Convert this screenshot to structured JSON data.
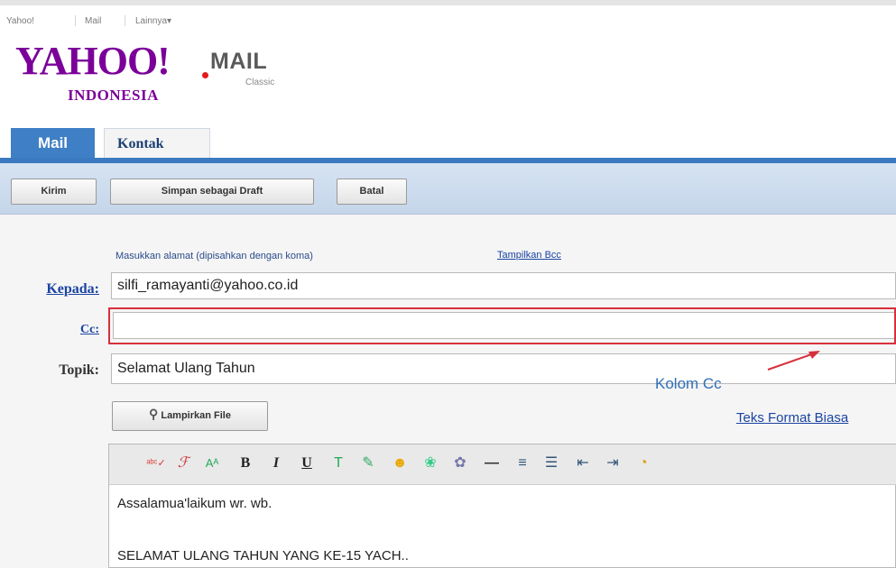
{
  "top_links": [
    "Yahoo!",
    "Mail",
    "Lainnya▾"
  ],
  "logo": {
    "main": "YAHOO!",
    "sub": "INDONESIA",
    "product": "MAIL",
    "edition": "Classic"
  },
  "tabs": [
    {
      "label": "Mail",
      "active": true
    },
    {
      "label": "Kontak",
      "active": false
    }
  ],
  "toolbar": {
    "send": "Kirim",
    "save_draft": "Simpan sebagai Draft",
    "cancel": "Batal"
  },
  "compose": {
    "address_hint": "Masukkan alamat (dipisahkan dengan koma)",
    "show_bcc": "Tampilkan Bcc",
    "to_label": "Kepada:",
    "to_value": "silfi_ramayanti@yahoo.co.id",
    "cc_label": "Cc:",
    "cc_value": "",
    "subject_label": "Topik:",
    "subject_value": "Selamat Ulang Tahun",
    "attach_label": "Lampirkan File",
    "plain_text_link": "Teks Format Biasa"
  },
  "annotation": {
    "text": "Kolom Cc",
    "color": "#d7303c"
  },
  "editor": {
    "toolbar_icons": [
      "spellcheck-icon",
      "font-icon",
      "font-size-icon",
      "bold-icon",
      "italic-icon",
      "underline-icon",
      "text-color-icon",
      "highlight-icon",
      "emoticon-icon",
      "image-icon",
      "stationery-icon",
      "horizontal-rule-icon",
      "align-icon",
      "bullet-list-icon",
      "outdent-icon",
      "indent-icon",
      "more-icon"
    ],
    "toolbar_glyphs": {
      "bold": "B",
      "italic": "I",
      "underline": "U"
    },
    "lines": [
      "Assalamua'laikum wr. wb.",
      "SELAMAT ULANG TAHUN YANG KE-15 YACH.."
    ]
  },
  "colors": {
    "accent": "#3f7fc5",
    "brand": "#7b0099",
    "annotation": "#d7303c",
    "link": "#1a44a2"
  }
}
